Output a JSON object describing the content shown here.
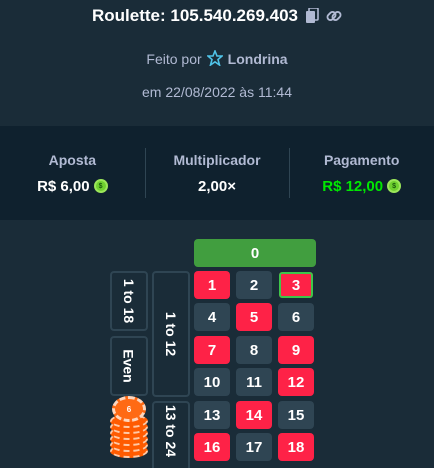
{
  "header": {
    "title": "Roulette: 105.540.269.403",
    "made_by_prefix": "Feito por",
    "username": "Londrina",
    "date": "em 22/08/2022 às 11:44"
  },
  "stats": {
    "bet_label": "Aposta",
    "bet_value": "R$ 6,00",
    "multiplier_label": "Multiplicador",
    "multiplier_value": "2,00×",
    "payout_label": "Pagamento",
    "payout_value": "R$ 12,00"
  },
  "colors": {
    "background": "#1a2c38",
    "panel": "#0f212e",
    "red": "#fe2247",
    "dark": "#2f4553",
    "green_zero": "#419e3f",
    "payout_green": "#00e701",
    "highlight": "#3ec64a"
  },
  "icons": {
    "copy": "copy-icon",
    "link": "link-icon",
    "user_rank": "vip-star-icon",
    "currency": "coin-icon"
  },
  "board": {
    "zero": "0",
    "numbers": [
      {
        "n": "1",
        "color": "red"
      },
      {
        "n": "2",
        "color": "black"
      },
      {
        "n": "3",
        "color": "red",
        "selected": true
      },
      {
        "n": "4",
        "color": "black"
      },
      {
        "n": "5",
        "color": "red"
      },
      {
        "n": "6",
        "color": "black"
      },
      {
        "n": "7",
        "color": "red"
      },
      {
        "n": "8",
        "color": "black"
      },
      {
        "n": "9",
        "color": "red"
      },
      {
        "n": "10",
        "color": "black"
      },
      {
        "n": "11",
        "color": "black"
      },
      {
        "n": "12",
        "color": "red"
      },
      {
        "n": "13",
        "color": "black"
      },
      {
        "n": "14",
        "color": "red"
      },
      {
        "n": "15",
        "color": "black"
      },
      {
        "n": "16",
        "color": "red"
      },
      {
        "n": "17",
        "color": "black"
      },
      {
        "n": "18",
        "color": "red"
      }
    ],
    "outside": {
      "low": "1 to 18",
      "even": "Even",
      "dozen1": "1 to 12",
      "dozen2": "13 to 24"
    },
    "chip_value": "6"
  }
}
